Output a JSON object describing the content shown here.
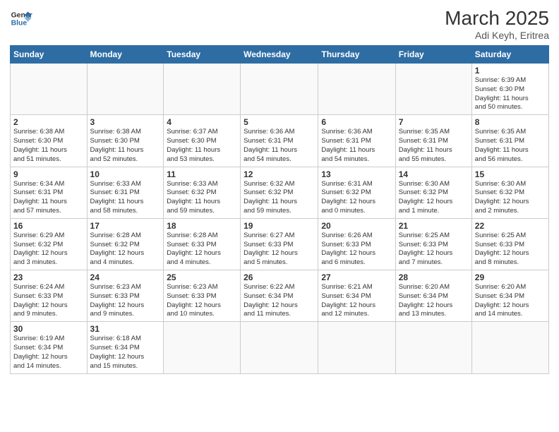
{
  "header": {
    "logo_general": "General",
    "logo_blue": "Blue",
    "month": "March 2025",
    "location": "Adi Keyh, Eritrea"
  },
  "weekdays": [
    "Sunday",
    "Monday",
    "Tuesday",
    "Wednesday",
    "Thursday",
    "Friday",
    "Saturday"
  ],
  "weeks": [
    [
      {
        "day": "",
        "info": ""
      },
      {
        "day": "",
        "info": ""
      },
      {
        "day": "",
        "info": ""
      },
      {
        "day": "",
        "info": ""
      },
      {
        "day": "",
        "info": ""
      },
      {
        "day": "",
        "info": ""
      },
      {
        "day": "1",
        "info": "Sunrise: 6:39 AM\nSunset: 6:30 PM\nDaylight: 11 hours\nand 50 minutes."
      }
    ],
    [
      {
        "day": "2",
        "info": "Sunrise: 6:38 AM\nSunset: 6:30 PM\nDaylight: 11 hours\nand 51 minutes."
      },
      {
        "day": "3",
        "info": "Sunrise: 6:38 AM\nSunset: 6:30 PM\nDaylight: 11 hours\nand 52 minutes."
      },
      {
        "day": "4",
        "info": "Sunrise: 6:37 AM\nSunset: 6:30 PM\nDaylight: 11 hours\nand 53 minutes."
      },
      {
        "day": "5",
        "info": "Sunrise: 6:36 AM\nSunset: 6:31 PM\nDaylight: 11 hours\nand 54 minutes."
      },
      {
        "day": "6",
        "info": "Sunrise: 6:36 AM\nSunset: 6:31 PM\nDaylight: 11 hours\nand 54 minutes."
      },
      {
        "day": "7",
        "info": "Sunrise: 6:35 AM\nSunset: 6:31 PM\nDaylight: 11 hours\nand 55 minutes."
      },
      {
        "day": "8",
        "info": "Sunrise: 6:35 AM\nSunset: 6:31 PM\nDaylight: 11 hours\nand 56 minutes."
      }
    ],
    [
      {
        "day": "9",
        "info": "Sunrise: 6:34 AM\nSunset: 6:31 PM\nDaylight: 11 hours\nand 57 minutes."
      },
      {
        "day": "10",
        "info": "Sunrise: 6:33 AM\nSunset: 6:31 PM\nDaylight: 11 hours\nand 58 minutes."
      },
      {
        "day": "11",
        "info": "Sunrise: 6:33 AM\nSunset: 6:32 PM\nDaylight: 11 hours\nand 59 minutes."
      },
      {
        "day": "12",
        "info": "Sunrise: 6:32 AM\nSunset: 6:32 PM\nDaylight: 11 hours\nand 59 minutes."
      },
      {
        "day": "13",
        "info": "Sunrise: 6:31 AM\nSunset: 6:32 PM\nDaylight: 12 hours\nand 0 minutes."
      },
      {
        "day": "14",
        "info": "Sunrise: 6:30 AM\nSunset: 6:32 PM\nDaylight: 12 hours\nand 1 minute."
      },
      {
        "day": "15",
        "info": "Sunrise: 6:30 AM\nSunset: 6:32 PM\nDaylight: 12 hours\nand 2 minutes."
      }
    ],
    [
      {
        "day": "16",
        "info": "Sunrise: 6:29 AM\nSunset: 6:32 PM\nDaylight: 12 hours\nand 3 minutes."
      },
      {
        "day": "17",
        "info": "Sunrise: 6:28 AM\nSunset: 6:32 PM\nDaylight: 12 hours\nand 4 minutes."
      },
      {
        "day": "18",
        "info": "Sunrise: 6:28 AM\nSunset: 6:33 PM\nDaylight: 12 hours\nand 4 minutes."
      },
      {
        "day": "19",
        "info": "Sunrise: 6:27 AM\nSunset: 6:33 PM\nDaylight: 12 hours\nand 5 minutes."
      },
      {
        "day": "20",
        "info": "Sunrise: 6:26 AM\nSunset: 6:33 PM\nDaylight: 12 hours\nand 6 minutes."
      },
      {
        "day": "21",
        "info": "Sunrise: 6:25 AM\nSunset: 6:33 PM\nDaylight: 12 hours\nand 7 minutes."
      },
      {
        "day": "22",
        "info": "Sunrise: 6:25 AM\nSunset: 6:33 PM\nDaylight: 12 hours\nand 8 minutes."
      }
    ],
    [
      {
        "day": "23",
        "info": "Sunrise: 6:24 AM\nSunset: 6:33 PM\nDaylight: 12 hours\nand 9 minutes."
      },
      {
        "day": "24",
        "info": "Sunrise: 6:23 AM\nSunset: 6:33 PM\nDaylight: 12 hours\nand 9 minutes."
      },
      {
        "day": "25",
        "info": "Sunrise: 6:23 AM\nSunset: 6:33 PM\nDaylight: 12 hours\nand 10 minutes."
      },
      {
        "day": "26",
        "info": "Sunrise: 6:22 AM\nSunset: 6:34 PM\nDaylight: 12 hours\nand 11 minutes."
      },
      {
        "day": "27",
        "info": "Sunrise: 6:21 AM\nSunset: 6:34 PM\nDaylight: 12 hours\nand 12 minutes."
      },
      {
        "day": "28",
        "info": "Sunrise: 6:20 AM\nSunset: 6:34 PM\nDaylight: 12 hours\nand 13 minutes."
      },
      {
        "day": "29",
        "info": "Sunrise: 6:20 AM\nSunset: 6:34 PM\nDaylight: 12 hours\nand 14 minutes."
      }
    ],
    [
      {
        "day": "30",
        "info": "Sunrise: 6:19 AM\nSunset: 6:34 PM\nDaylight: 12 hours\nand 14 minutes."
      },
      {
        "day": "31",
        "info": "Sunrise: 6:18 AM\nSunset: 6:34 PM\nDaylight: 12 hours\nand 15 minutes."
      },
      {
        "day": "",
        "info": ""
      },
      {
        "day": "",
        "info": ""
      },
      {
        "day": "",
        "info": ""
      },
      {
        "day": "",
        "info": ""
      },
      {
        "day": "",
        "info": ""
      }
    ]
  ]
}
